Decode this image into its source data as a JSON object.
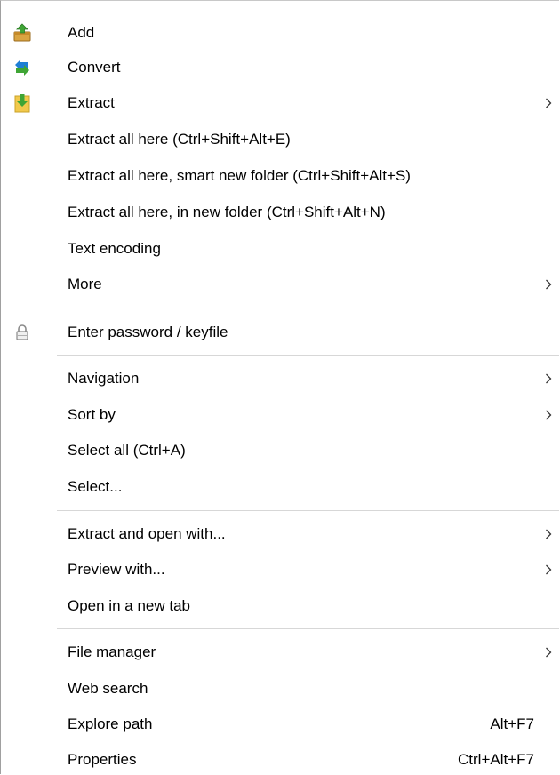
{
  "menu": {
    "items": [
      {
        "label": "Add",
        "icon": "add-archive-icon"
      },
      {
        "label": "Convert",
        "icon": "convert-icon"
      },
      {
        "label": "Extract",
        "icon": "extract-icon",
        "submenu": true
      },
      {
        "label": "Extract all here (Ctrl+Shift+Alt+E)"
      },
      {
        "label": "Extract all here, smart new folder (Ctrl+Shift+Alt+S)"
      },
      {
        "label": "Extract all here, in new folder (Ctrl+Shift+Alt+N)"
      },
      {
        "label": "Text encoding"
      },
      {
        "label": "More",
        "submenu": true
      },
      {
        "label": "Enter password / keyfile",
        "icon": "lock-icon"
      },
      {
        "label": "Navigation",
        "submenu": true
      },
      {
        "label": "Sort by",
        "submenu": true
      },
      {
        "label": "Select all (Ctrl+A)"
      },
      {
        "label": "Select..."
      },
      {
        "label": "Extract and open with...",
        "submenu": true
      },
      {
        "label": "Preview with...",
        "submenu": true
      },
      {
        "label": "Open in a new tab"
      },
      {
        "label": "File manager",
        "submenu": true
      },
      {
        "label": "Web search"
      },
      {
        "label": "Explore path",
        "shortcut": "Alt+F7"
      },
      {
        "label": "Properties",
        "shortcut": "Ctrl+Alt+F7"
      }
    ]
  },
  "colors": {
    "icon_green": "#3fa535",
    "icon_blue": "#1e7fd6",
    "icon_folder": "#f2c94c",
    "separator": "#d7d7d7"
  }
}
